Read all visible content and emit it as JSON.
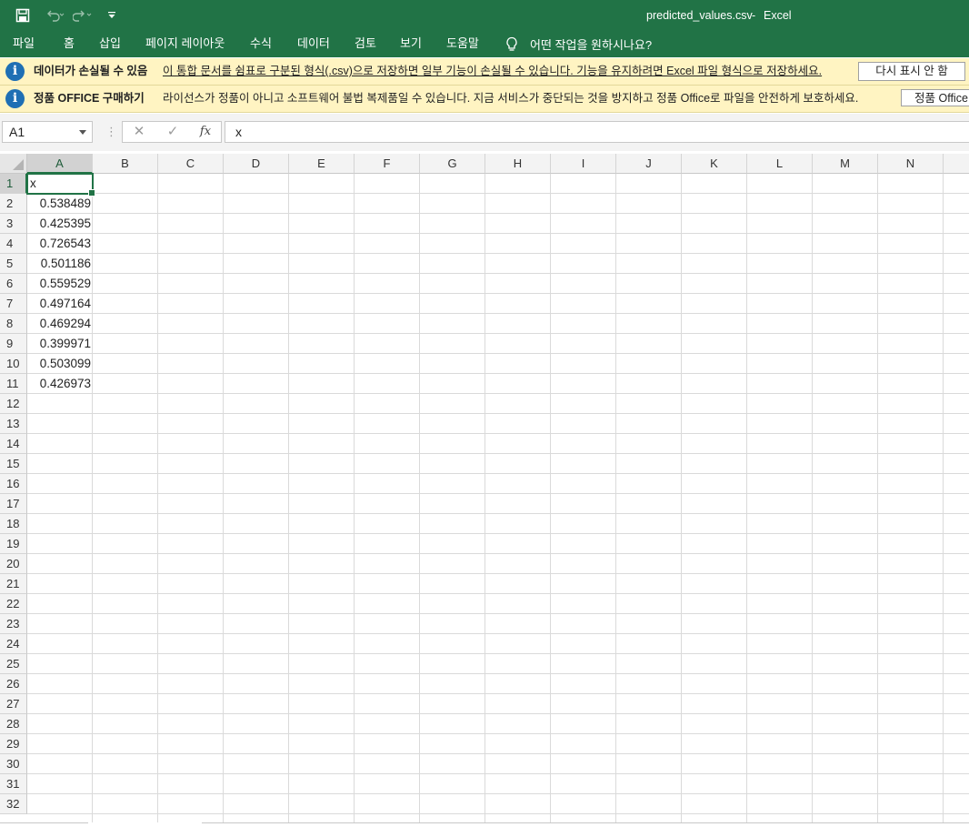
{
  "window": {
    "file_name": "predicted_values.csv",
    "separator": "-",
    "app_name": "Excel"
  },
  "quick_access": [
    "save-icon",
    "undo-icon",
    "redo-icon",
    "customize-qat-icon"
  ],
  "ribbon": {
    "tabs": [
      "파일",
      "홈",
      "삽입",
      "페이지 레이아웃",
      "수식",
      "데이터",
      "검토",
      "보기",
      "도움말"
    ],
    "tell_me": "어떤 작업을 원하시나요?"
  },
  "message_bars": [
    {
      "title": "데이터가 손실될 수 있음",
      "message": "이 통합 문서를 쉼표로 구분된 형식(.csv)으로 저장하면 일부 기능이 손실될 수 있습니다. 기능을 유지하려면 Excel 파일 형식으로 저장하세요.",
      "button": "다시 표시 안 함"
    },
    {
      "title": "정품 OFFICE 구매하기",
      "message": "라이선스가 정품이 아니고 소프트웨어 불법 복제품일 수 있습니다. 지금 서비스가 중단되는 것을 방지하고 정품 Office로 파일을 안전하게 보호하세요.",
      "button": "정품 Office"
    }
  ],
  "formula_bar": {
    "name_box": "A1",
    "fx_label": "fx",
    "content": "x"
  },
  "sheet": {
    "columns": [
      "A",
      "B",
      "C",
      "D",
      "E",
      "F",
      "G",
      "H",
      "I",
      "J",
      "K",
      "L",
      "M",
      "N"
    ],
    "row_count": 32,
    "selected_cell": "A1",
    "column_A": [
      "x",
      "0.538489",
      "0.425395",
      "0.726543",
      "0.501186",
      "0.559529",
      "0.497164",
      "0.469294",
      "0.399971",
      "0.503099",
      "0.426973"
    ]
  }
}
